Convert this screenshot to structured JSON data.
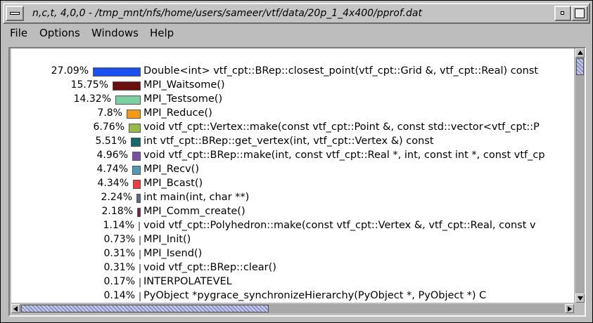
{
  "window": {
    "title": "n,c,t, 4,0,0 - /tmp_mnt/nfs/home/users/sameer/vtf/data/20p_1_4x400/pprof.dat"
  },
  "menubar": {
    "items": [
      {
        "label": "File"
      },
      {
        "label": "Options"
      },
      {
        "label": "Windows"
      },
      {
        "label": "Help"
      }
    ]
  },
  "profile": {
    "rows": [
      {
        "pct": "27.09%",
        "name": "Double<int> vtf_cpt::BRep::closest_point(vtf_cpt::Grid &, vtf_cpt::Real) const",
        "value": 27.09,
        "color": "#1a4ff0"
      },
      {
        "pct": "15.75%",
        "name": "MPI_Waitsome()",
        "value": 15.75,
        "color": "#6b0f0f"
      },
      {
        "pct": "14.32%",
        "name": "MPI_Testsome()",
        "value": 14.32,
        "color": "#7ccfa0"
      },
      {
        "pct": "7.8%",
        "name": "MPI_Reduce()",
        "value": 7.8,
        "color": "#f59a14"
      },
      {
        "pct": "6.76%",
        "name": "void vtf_cpt::Vertex::make(const vtf_cpt::Point &, const std::vector<vtf_cpt::P",
        "value": 6.76,
        "color": "#9bb84a"
      },
      {
        "pct": "5.51%",
        "name": "int vtf_cpt::BRep::get_vertex(int, vtf_cpt::Vertex &) const",
        "value": 5.51,
        "color": "#166a6a"
      },
      {
        "pct": "4.96%",
        "name": "void vtf_cpt::BRep::make(int, const vtf_cpt::Real *, int, const int *, const vtf_cp",
        "value": 4.96,
        "color": "#7a4ea8"
      },
      {
        "pct": "4.74%",
        "name": "MPI_Recv()",
        "value": 4.74,
        "color": "#4f9ab0"
      },
      {
        "pct": "4.34%",
        "name": "MPI_Bcast()",
        "value": 4.34,
        "color": "#f03c3c"
      },
      {
        "pct": "2.24%",
        "name": "int main(int, char **)",
        "value": 2.24,
        "color": "#5a6a8a"
      },
      {
        "pct": "2.18%",
        "name": "MPI_Comm_create()",
        "value": 2.18,
        "color": "#7a1a4a"
      },
      {
        "pct": "1.14%",
        "name": "void vtf_cpt::Polyhedron::make(const vtf_cpt::Vertex &, vtf_cpt::Real, const v",
        "value": 1.14,
        "color": "#8a8a8a"
      },
      {
        "pct": "0.73%",
        "name": "MPI_Init()",
        "value": 0.73,
        "color": "#8a8a8a"
      },
      {
        "pct": "0.31%",
        "name": "MPI_Isend()",
        "value": 0.31,
        "color": "#8a8a8a"
      },
      {
        "pct": "0.31%",
        "name": "void vtf_cpt::BRep::clear()",
        "value": 0.31,
        "color": "#8a8a8a"
      },
      {
        "pct": "0.17%",
        "name": "INTERPOLATEVEL",
        "value": 0.17,
        "color": "#8a8a8a"
      },
      {
        "pct": "0.14%",
        "name": "PyObject *pygrace_synchronizeHierarchy(PyObject *, PyObject *) C",
        "value": 0.14,
        "color": "#8a8a8a"
      }
    ]
  }
}
